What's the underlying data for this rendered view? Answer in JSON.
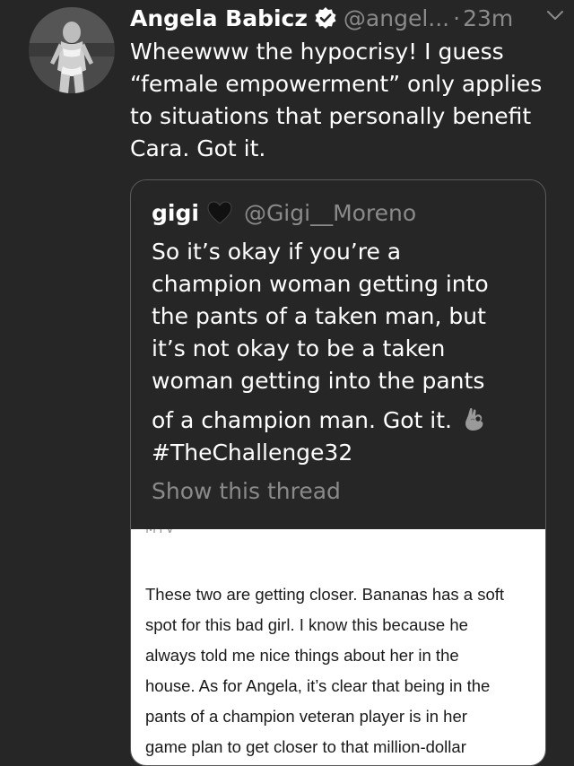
{
  "tweet": {
    "author_name": "Angela Babicz",
    "handle": "@angel...",
    "separator": "·",
    "time": "23m",
    "text": "Wheewww the hypocrisy! I guess “female empowerment” only applies to situations that personally benefit Cara. Got it."
  },
  "icons": {
    "verified": "verified-badge-icon",
    "menu": "chevron-down-icon",
    "heart": "black-heart-icon",
    "emoji": "ok-hand-emoji-icon"
  },
  "quote": {
    "name": "gigi",
    "handle": "@Gigi__Moreno",
    "lines": [
      "So it’s okay if you’re a",
      "champion woman getting into",
      "the pants of a taken man, but",
      "it’s not okay to be a taken",
      "woman getting into the pants",
      "of a champion man. Got it.",
      "#TheChallenge32"
    ],
    "show_thread": "Show this thread",
    "media": {
      "source": "MTV",
      "lines": [
        "These two are getting closer. Bananas has a soft",
        "spot for this bad girl. I know this because he",
        "always told me nice things about her in the",
        "house. As for Angela, it’s clear that being in the",
        "pants of a champion veteran player is in her",
        "game plan to get closer to that million-dollar"
      ]
    }
  },
  "colors": {
    "background": "#262626",
    "text": "#ffffff",
    "muted": "#8a8a8a",
    "border": "#5a5a5a"
  }
}
